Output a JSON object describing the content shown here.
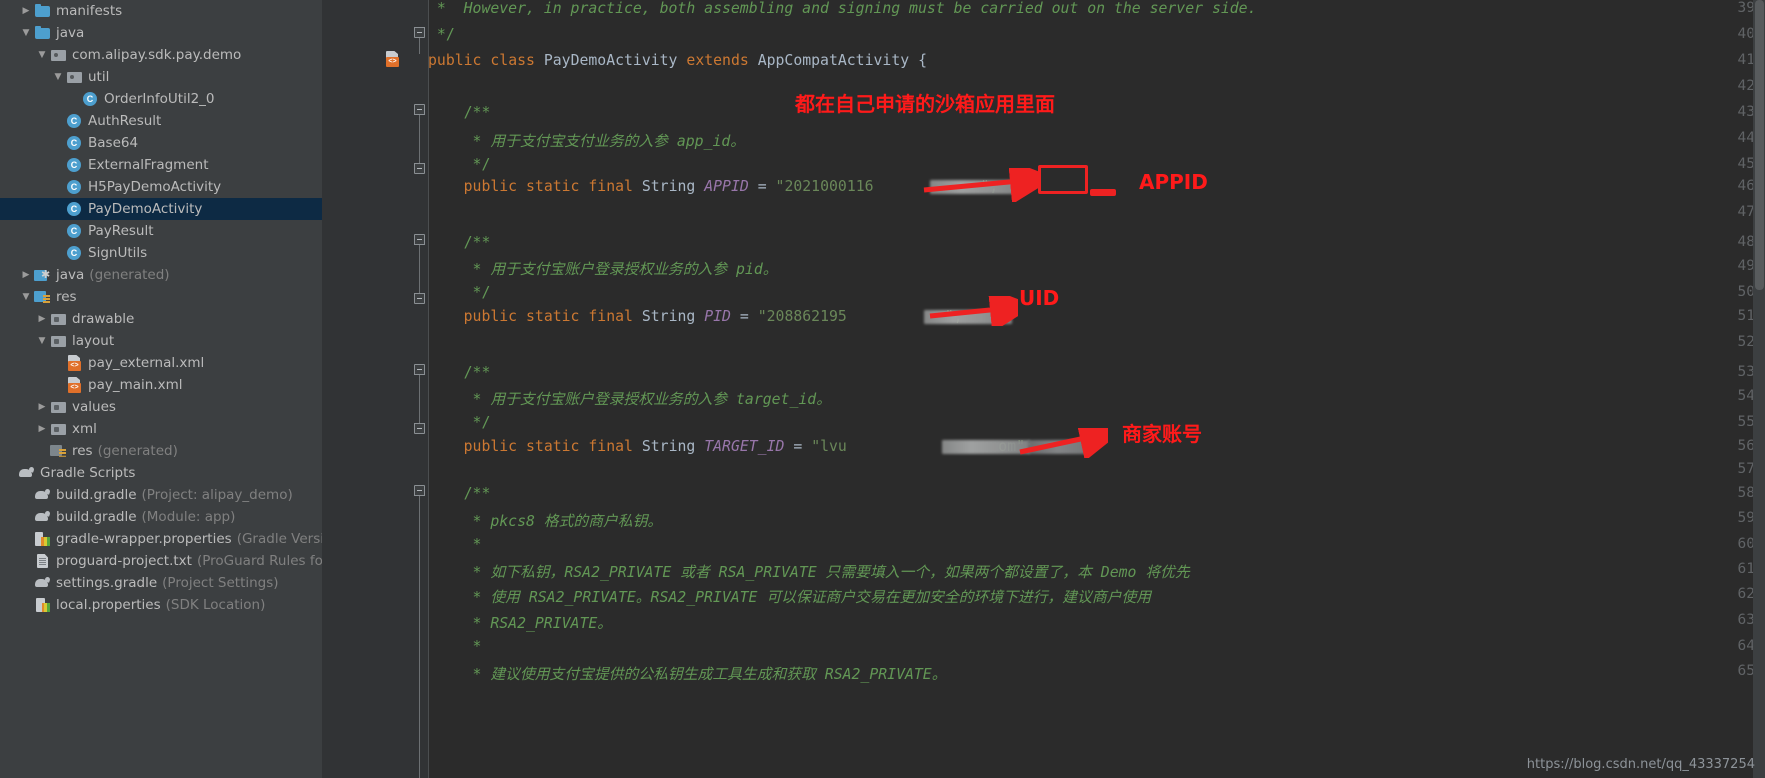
{
  "app": {
    "theme_bg": "#2b2b2b",
    "sidebar_bg": "#3c3f41",
    "accent": "#4d9fce",
    "annotation_color": "#ff1a1a"
  },
  "project_tree": [
    {
      "indent": 1,
      "twisty": "▶",
      "icon": "folder-icon",
      "label": "manifests",
      "sub": "",
      "selected": false
    },
    {
      "indent": 1,
      "twisty": "▼",
      "icon": "folder-icon",
      "label": "java",
      "sub": "",
      "selected": false
    },
    {
      "indent": 2,
      "twisty": "▼",
      "icon": "package-icon",
      "label": "com.alipay.sdk.pay.demo",
      "sub": "",
      "selected": false
    },
    {
      "indent": 3,
      "twisty": "▼",
      "icon": "package-icon",
      "label": "util",
      "sub": "",
      "selected": false
    },
    {
      "indent": 4,
      "twisty": "",
      "icon": "class-icon",
      "label": "OrderInfoUtil2_0",
      "sub": "",
      "selected": false
    },
    {
      "indent": 3,
      "twisty": "",
      "icon": "class-icon",
      "label": "AuthResult",
      "sub": "",
      "selected": false
    },
    {
      "indent": 3,
      "twisty": "",
      "icon": "class-icon",
      "label": "Base64",
      "sub": "",
      "selected": false
    },
    {
      "indent": 3,
      "twisty": "",
      "icon": "class-icon",
      "label": "ExternalFragment",
      "sub": "",
      "selected": false
    },
    {
      "indent": 3,
      "twisty": "",
      "icon": "class-icon",
      "label": "H5PayDemoActivity",
      "sub": "",
      "selected": false
    },
    {
      "indent": 3,
      "twisty": "",
      "icon": "class-icon",
      "label": "PayDemoActivity",
      "sub": "",
      "selected": true
    },
    {
      "indent": 3,
      "twisty": "",
      "icon": "class-icon",
      "label": "PayResult",
      "sub": "",
      "selected": false
    },
    {
      "indent": 3,
      "twisty": "",
      "icon": "class-icon",
      "label": "SignUtils",
      "sub": "",
      "selected": false
    },
    {
      "indent": 1,
      "twisty": "▶",
      "icon": "generated-folder-icon",
      "label": "java",
      "sub": "(generated)",
      "selected": false
    },
    {
      "indent": 1,
      "twisty": "▼",
      "icon": "res-folder-icon",
      "label": "res",
      "sub": "",
      "selected": false
    },
    {
      "indent": 2,
      "twisty": "▶",
      "icon": "directory-icon",
      "label": "drawable",
      "sub": "",
      "selected": false
    },
    {
      "indent": 2,
      "twisty": "▼",
      "icon": "directory-icon",
      "label": "layout",
      "sub": "",
      "selected": false
    },
    {
      "indent": 3,
      "twisty": "",
      "icon": "xml-layout-icon",
      "label": "pay_external.xml",
      "sub": "",
      "selected": false
    },
    {
      "indent": 3,
      "twisty": "",
      "icon": "xml-layout-icon",
      "label": "pay_main.xml",
      "sub": "",
      "selected": false
    },
    {
      "indent": 2,
      "twisty": "▶",
      "icon": "directory-icon",
      "label": "values",
      "sub": "",
      "selected": false
    },
    {
      "indent": 2,
      "twisty": "▶",
      "icon": "directory-icon",
      "label": "xml",
      "sub": "",
      "selected": false
    },
    {
      "indent": 2,
      "twisty": "",
      "icon": "res-generated-icon",
      "label": "res",
      "sub": "(generated)",
      "selected": false
    },
    {
      "indent": 0,
      "twisty": "",
      "icon": "gradle-icon",
      "label": "Gradle Scripts",
      "sub": "",
      "selected": false
    },
    {
      "indent": 1,
      "twisty": "",
      "icon": "gradle-icon",
      "label": "build.gradle",
      "sub": "(Project: alipay_demo)",
      "selected": false
    },
    {
      "indent": 1,
      "twisty": "",
      "icon": "gradle-icon",
      "label": "build.gradle",
      "sub": "(Module: app)",
      "selected": false
    },
    {
      "indent": 1,
      "twisty": "",
      "icon": "properties-icon",
      "label": "gradle-wrapper.properties",
      "sub": "(Gradle Version)",
      "selected": false
    },
    {
      "indent": 1,
      "twisty": "",
      "icon": "txt-file-icon",
      "label": "proguard-project.txt",
      "sub": "(ProGuard Rules for ap",
      "selected": false
    },
    {
      "indent": 1,
      "twisty": "",
      "icon": "gradle-icon",
      "label": "settings.gradle",
      "sub": "(Project Settings)",
      "selected": false
    },
    {
      "indent": 1,
      "twisty": "",
      "icon": "local-properties-icon",
      "label": "local.properties",
      "sub": "(SDK Location)",
      "selected": false
    }
  ],
  "editor": {
    "first_line_number": 39,
    "last_line_number": 65,
    "line_numbers": [
      39,
      40,
      41,
      42,
      43,
      44,
      45,
      46,
      47,
      48,
      49,
      50,
      51,
      52,
      53,
      54,
      55,
      56,
      57,
      58,
      59,
      60,
      61,
      62,
      63,
      64,
      65
    ],
    "lines": {
      "39": " *  However, in practice, both assembling and signing must be carried out on the server side.",
      "40": " */",
      "41": "public class PayDemoActivity extends AppCompatActivity {",
      "42": "",
      "43": "    /**",
      "44": "     * 用于支付宝支付业务的入参 app_id。",
      "45": "     */",
      "46": "    public static final String APPID = \"2021000116        \";",
      "47": "",
      "48": "    /**",
      "49": "     * 用于支付宝账户登录授权业务的入参 pid。",
      "50": "     */",
      "51": "    public static final String PID = \"208862195        \";",
      "52": "",
      "53": "    /**",
      "54": "     * 用于支付宝账户登录授权业务的入参 target_id。",
      "55": "     */",
      "56": "    public static final String TARGET_ID = \"lvu            om\";",
      "57": "",
      "58": "    /**",
      "59": "     * pkcs8 格式的商户私钥。",
      "60": "     *",
      "61": "     * 如下私钥，RSA2_PRIVATE 或者 RSA_PRIVATE 只需要填入一个，如果两个都设置了，本 Demo 将优先",
      "62": "     * 使用 RSA2_PRIVATE。RSA2_PRIVATE 可以保证商户交易在更加安全的环境下进行，建议商户使用",
      "63": "     * RSA2_PRIVATE。",
      "64": "     *",
      "65": "     * 建议使用支付宝提供的公私钥生成工具生成和获取 RSA2_PRIVATE。"
    },
    "tokens": {
      "kw_public": "public",
      "kw_class": "class",
      "kw_extends": "extends",
      "kw_static": "static",
      "kw_final": "final",
      "type_string": "String",
      "cls_paydemoactivity": "PayDemoActivity",
      "cls_appcompatactivity": "AppCompatActivity",
      "brace_open": "{",
      "field_appid": "APPID",
      "field_pid": "PID",
      "field_target": "TARGET_ID",
      "eq": "=",
      "semicolon": ";",
      "str_appid_visible": "\"2021000116",
      "str_appid_tail": "\";",
      "str_pid_visible": "\"208862195",
      "str_pid_tail": "\";",
      "str_target_visible": "\"lvu",
      "str_target_mid": "\"",
      "str_target_tail": "om\";"
    }
  },
  "annotations": [
    {
      "id": "sandbox-note",
      "text": "都在自己申请的沙箱应用里面"
    },
    {
      "id": "appid-label",
      "text": "APPID"
    },
    {
      "id": "uid-label",
      "text": "UID"
    },
    {
      "id": "merchant-account-label",
      "text": "商家账号"
    }
  ],
  "watermark": {
    "text": "https://blog.csdn.net/qq_43337254"
  }
}
